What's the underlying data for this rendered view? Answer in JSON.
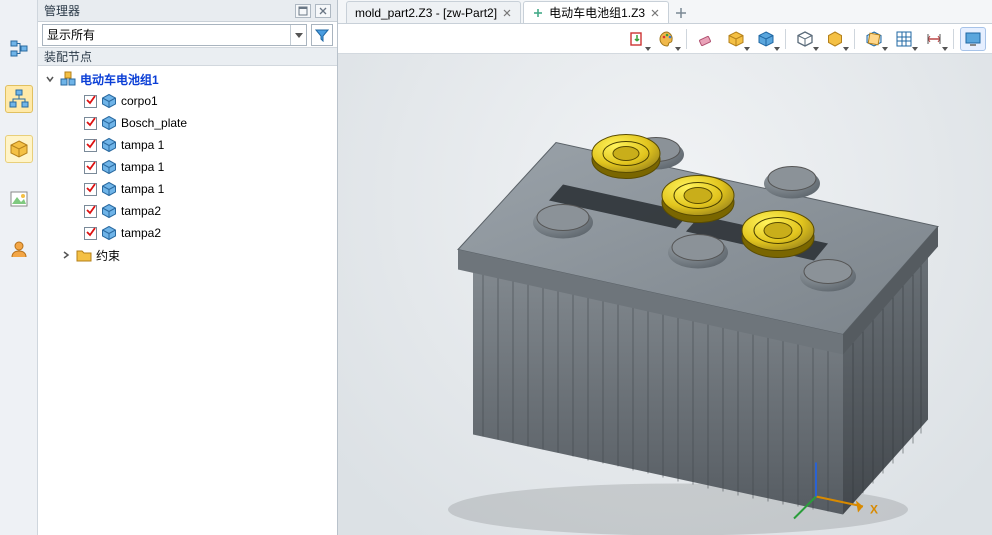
{
  "panel": {
    "title": "管理器",
    "filter_value": "显示所有",
    "subheader": "装配节点",
    "root_label": "电动车电池组1",
    "items": [
      {
        "label": "corpo1"
      },
      {
        "label": "Bosch_plate"
      },
      {
        "label": "tampa 1"
      },
      {
        "label": "tampa 1"
      },
      {
        "label": "tampa 1"
      },
      {
        "label": "tampa2"
      },
      {
        "label": "tampa2"
      }
    ],
    "folder_label": "约束"
  },
  "tabs": [
    {
      "label": "mold_part2.Z3 - [zw-Part2]",
      "kind": "full",
      "active": false
    },
    {
      "label": "电动车电池组1.Z3",
      "kind": "new",
      "active": true
    }
  ],
  "viewport": {
    "axis_x": "X"
  },
  "icons": {
    "vstrip": [
      "tree-icon",
      "hierarchy-icon",
      "part-box-icon",
      "image-icon",
      "user-icon"
    ],
    "toolbar": [
      "import-icon",
      "palette-icon",
      "eraser-icon",
      "box-color-icon",
      "box-shade-icon",
      "cube-wire-icon",
      "hex-color-icon",
      "section-icon",
      "grid-icon",
      "dimension-icon",
      "screen-icon"
    ]
  }
}
